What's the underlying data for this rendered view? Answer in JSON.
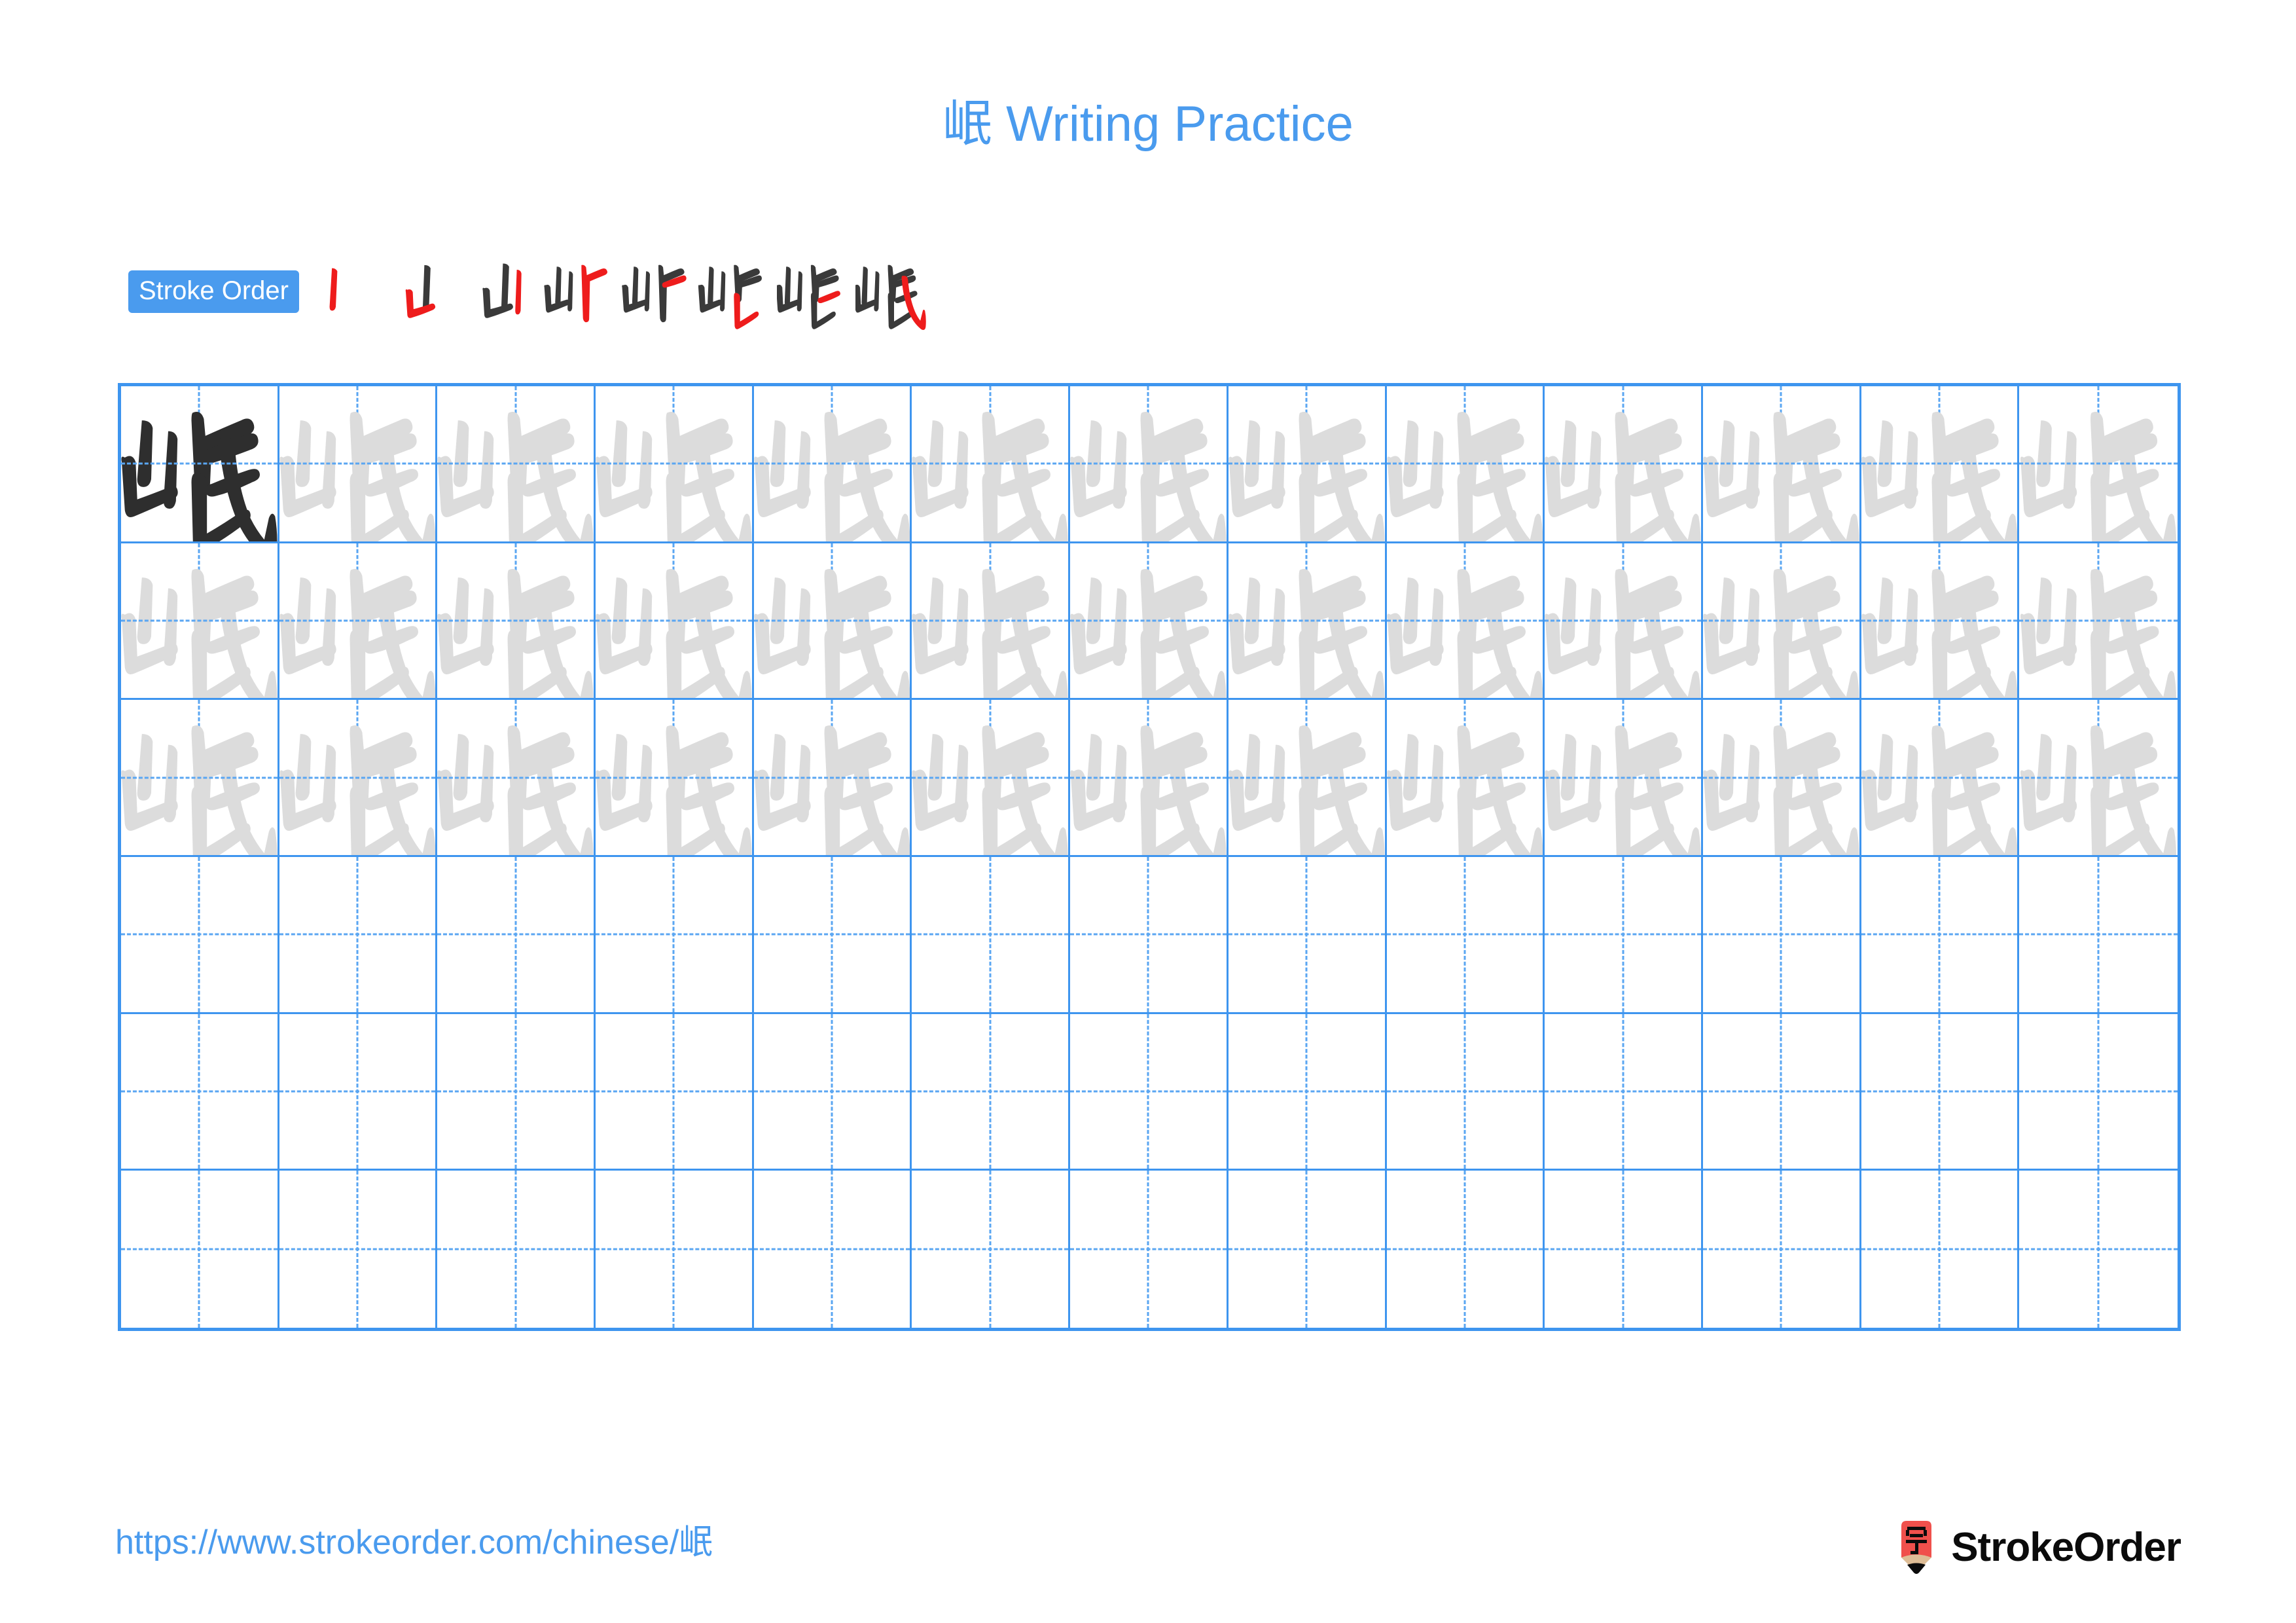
{
  "character": "岷",
  "title": "岷 Writing Practice",
  "title_color": "#4a9bee",
  "stroke_order": {
    "badge_label": "Stroke Order",
    "badge_bg": "#4a9bee",
    "badge_text_color": "#ffffff",
    "total_strokes": 8,
    "new_stroke_color": "#ee1c1c",
    "done_stroke_color": "#3a3a3a",
    "steps": [
      {
        "index": 1,
        "strokes_shown": 1,
        "new_stroke": "竖 (vertical)"
      },
      {
        "index": 2,
        "strokes_shown": 2,
        "new_stroke": "竖折 (vertical-turn)"
      },
      {
        "index": 3,
        "strokes_shown": 3,
        "new_stroke": "竖 (vertical)"
      },
      {
        "index": 4,
        "strokes_shown": 4,
        "new_stroke": "横折 (horizontal-turn)"
      },
      {
        "index": 5,
        "strokes_shown": 5,
        "new_stroke": "横 (horizontal)"
      },
      {
        "index": 6,
        "strokes_shown": 6,
        "new_stroke": "竖提 (vertical-rise)"
      },
      {
        "index": 7,
        "strokes_shown": 7,
        "new_stroke": "横 (horizontal)"
      },
      {
        "index": 8,
        "strokes_shown": 8,
        "new_stroke": "斜钩 (slanted-hook)"
      }
    ]
  },
  "grid": {
    "columns": 13,
    "rows": 6,
    "line_color": "#3e95ef",
    "guide_color": "#5aa6f2",
    "dark_glyph_color": "#2e2e2e",
    "trace_glyph_color": "#dcdcdc",
    "rows_detail": [
      {
        "row": 1,
        "filled_cells": 13,
        "first_cell_style": "dark-model",
        "other_cells_style": "light-trace"
      },
      {
        "row": 2,
        "filled_cells": 13,
        "first_cell_style": "light-trace",
        "other_cells_style": "light-trace"
      },
      {
        "row": 3,
        "filled_cells": 13,
        "first_cell_style": "light-trace",
        "other_cells_style": "light-trace"
      },
      {
        "row": 4,
        "filled_cells": 0,
        "first_cell_style": "empty",
        "other_cells_style": "empty"
      },
      {
        "row": 5,
        "filled_cells": 0,
        "first_cell_style": "empty",
        "other_cells_style": "empty"
      },
      {
        "row": 6,
        "filled_cells": 0,
        "first_cell_style": "empty",
        "other_cells_style": "empty"
      }
    ]
  },
  "footer": {
    "url": "https://www.strokeorder.com/chinese/岷",
    "url_color": "#4a9bee",
    "brand_name": "StrokeOrder",
    "logo_char": "字",
    "logo_body_color": "#f0504c",
    "logo_wood_color": "#debd96",
    "logo_tip_color": "#0b0b0b"
  }
}
